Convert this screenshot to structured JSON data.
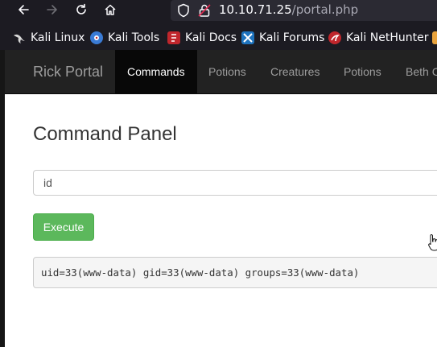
{
  "browser": {
    "url_host": "10.10.71.25",
    "url_path": "/portal.php",
    "icons": [
      "back-arrow-icon",
      "forward-arrow-icon",
      "reload-icon",
      "home-icon",
      "shield-icon",
      "lock-icon"
    ]
  },
  "bookmarks": [
    {
      "label": "Kali Linux",
      "icon": "kali-dragon-icon",
      "color": "#d7d7d7"
    },
    {
      "label": "Kali Tools",
      "icon": "kali-tools-icon",
      "color": "#3a7bd5"
    },
    {
      "label": "Kali Docs",
      "icon": "kali-docs-icon",
      "color": "#c0262c"
    },
    {
      "label": "Kali Forums",
      "icon": "kali-forums-icon",
      "color": "#1e73be"
    },
    {
      "label": "Kali NetHunter",
      "icon": "kali-nethunter-icon",
      "color": "#c0262c"
    }
  ],
  "navbar": {
    "brand": "Rick Portal",
    "items": [
      "Commands",
      "Potions",
      "Creatures",
      "Potions",
      "Beth C"
    ],
    "active_index": 0
  },
  "main": {
    "heading": "Command Panel",
    "command_value": "id",
    "execute_label": "Execute",
    "output": "uid=33(www-data) gid=33(www-data) groups=33(www-data)"
  },
  "colors": {
    "navbar_bg": "#222222",
    "execute_bg": "#5cb85c",
    "browser_bg": "#1c1b22"
  }
}
